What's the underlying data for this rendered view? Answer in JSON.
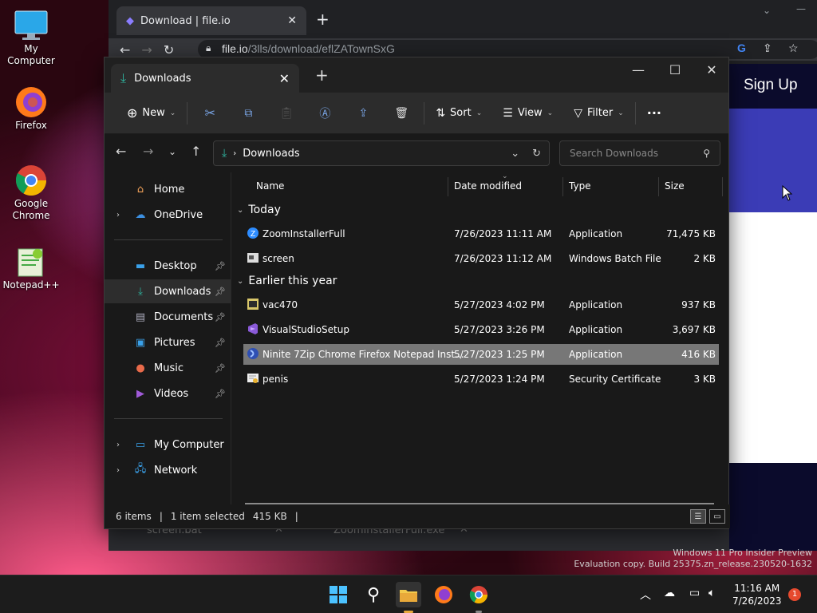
{
  "desktop": {
    "icons": [
      {
        "label": "My Computer"
      },
      {
        "label": "Firefox"
      },
      {
        "label": "Google Chrome"
      },
      {
        "label": "Notepad++"
      }
    ],
    "watermark": {
      "line1": "Windows 11 Pro Insider Preview",
      "line2": "Evaluation copy. Build 25375.zn_release.230520-1632"
    }
  },
  "browser": {
    "tab_title": "Download | file.io",
    "url_host": "file.io",
    "url_path": "/3lls/download/eflZATownSxG",
    "signup_label": "Sign Up",
    "downloads": [
      "screen.bat",
      "ZoomInstallerFull.exe"
    ]
  },
  "explorer": {
    "tab_title": "Downloads",
    "toolbar": {
      "new_label": "New",
      "sort_label": "Sort",
      "view_label": "View",
      "filter_label": "Filter",
      "more_label": "···"
    },
    "breadcrumb": "Downloads",
    "search_placeholder": "Search Downloads",
    "sidebar": {
      "home": "Home",
      "onedrive": "OneDrive",
      "desktop": "Desktop",
      "downloads": "Downloads",
      "documents": "Documents",
      "pictures": "Pictures",
      "music": "Music",
      "videos": "Videos",
      "my_computer": "My Computer",
      "network": "Network"
    },
    "columns": {
      "name": "Name",
      "date": "Date modified",
      "type": "Type",
      "size": "Size"
    },
    "groups": {
      "today": "Today",
      "earlier": "Earlier this year"
    },
    "files": [
      {
        "name": "ZoomInstallerFull",
        "date": "7/26/2023 11:11 AM",
        "type": "Application",
        "size": "71,475 KB"
      },
      {
        "name": "screen",
        "date": "7/26/2023 11:12 AM",
        "type": "Windows Batch File",
        "size": "2 KB"
      },
      {
        "name": "vac470",
        "date": "5/27/2023 4:02 PM",
        "type": "Application",
        "size": "937 KB"
      },
      {
        "name": "VisualStudioSetup",
        "date": "5/27/2023 3:26 PM",
        "type": "Application",
        "size": "3,697 KB"
      },
      {
        "name": "Ninite 7Zip Chrome Firefox Notepad Inst...",
        "date": "5/27/2023 1:25 PM",
        "type": "Application",
        "size": "416 KB"
      },
      {
        "name": "penis",
        "date": "5/27/2023 1:24 PM",
        "type": "Security Certificate",
        "size": "3 KB"
      }
    ],
    "status": {
      "items": "6 items",
      "selected": "1 item selected",
      "size": "415 KB"
    }
  },
  "taskbar": {
    "time": "11:16 AM",
    "date": "7/26/2023",
    "notifications": "1"
  },
  "colors": {
    "selection": "#777777",
    "accent_download": "#2fb5a0"
  }
}
